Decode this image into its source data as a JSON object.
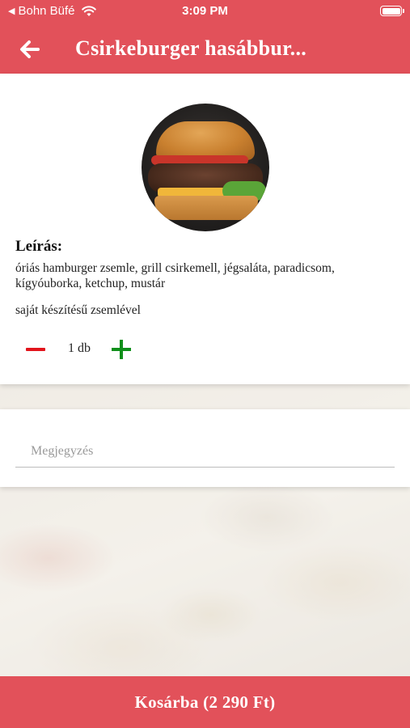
{
  "status_bar": {
    "back_app": "Bohn Büfé",
    "time": "3:09 PM"
  },
  "header": {
    "title": "Csirkeburger hasábbur...",
    "back_icon": "arrow-left-icon"
  },
  "product": {
    "image_icon": "burger-photo",
    "description_heading": "Leírás:",
    "description": "óriás hamburger zsemle, grill csirkemell, jégsaláta, paradicsom, kígyóuborka, ketchup, mustár",
    "extra_note": "saját készítésű zsemlével",
    "quantity_label": "1 db"
  },
  "note": {
    "placeholder": "Megjegyzés",
    "value": ""
  },
  "cart": {
    "label": "Kosárba (2 290 Ft)"
  },
  "colors": {
    "accent": "#e2515a",
    "minus": "#e2141c",
    "plus": "#0f8f1a"
  }
}
